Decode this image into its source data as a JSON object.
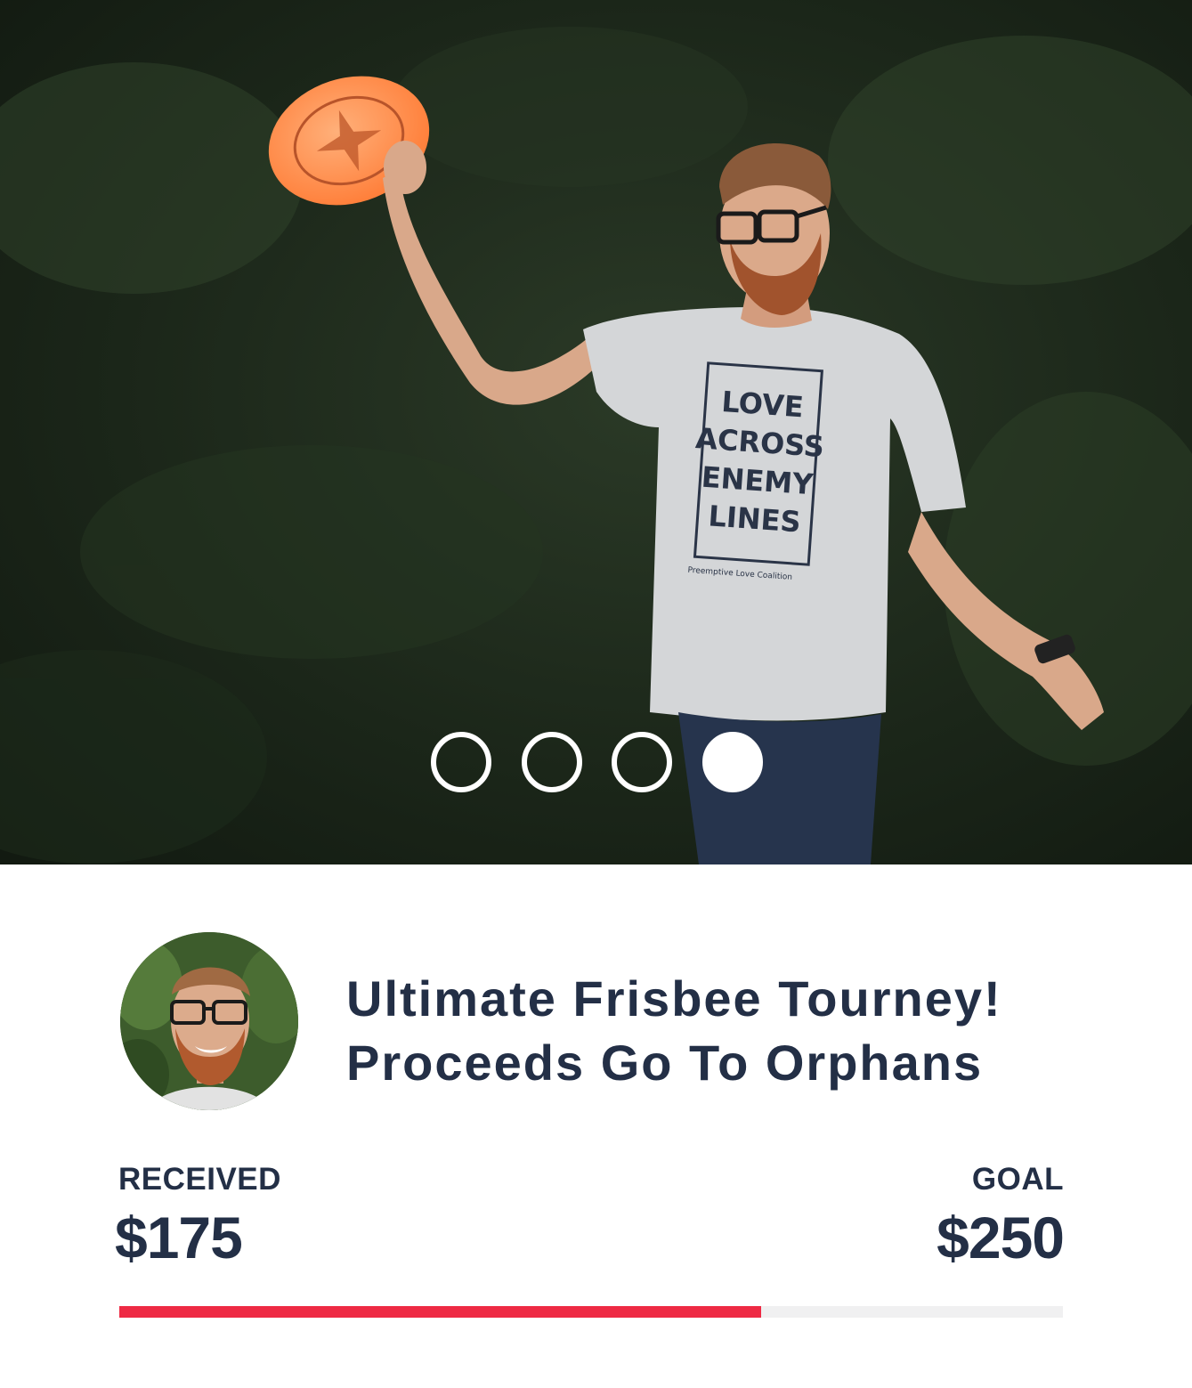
{
  "carousel": {
    "slide_count": 4,
    "active_index": 3,
    "shirt_text": [
      "LOVE",
      "ACROSS",
      "ENEMY",
      "LINES"
    ],
    "shirt_caption": "Preemptive Love Coalition"
  },
  "campaign": {
    "title_line1": "Ultimate Frisbee Tourney!",
    "title_line2": "Proceeds Go To Orphans",
    "received_label": "RECEIVED",
    "received_amount": "$175",
    "goal_label": "GOAL",
    "goal_amount": "$250",
    "progress_fraction": 0.68
  },
  "colors": {
    "text": "#232f46",
    "progress": "#ee2a44",
    "track": "#f0f0f1"
  },
  "icons": {
    "avatar": "user-avatar-photo",
    "dots": "carousel-dot-indicator"
  }
}
